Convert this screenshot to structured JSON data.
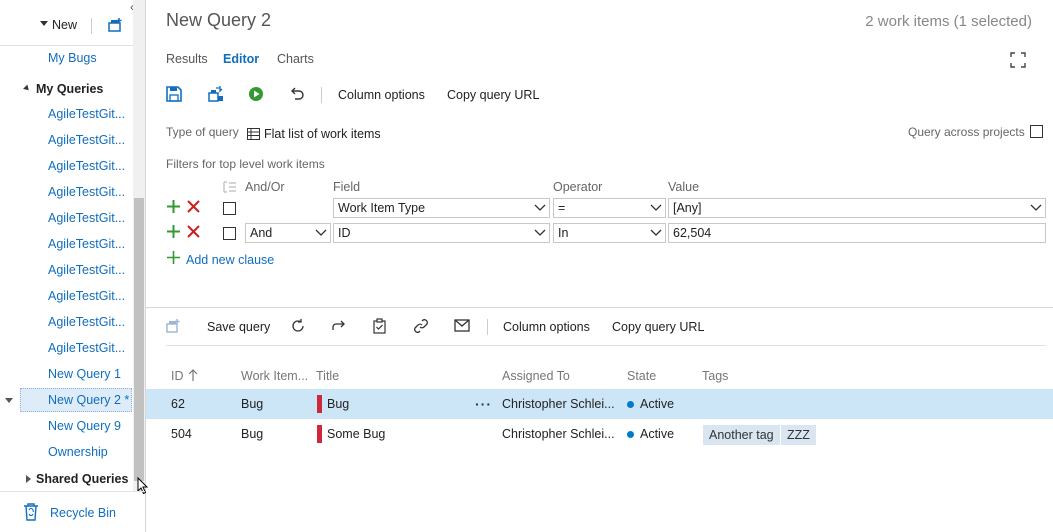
{
  "sidebar": {
    "new_label": "New",
    "items_top": [
      {
        "label": "My Bugs"
      }
    ],
    "my_queries_heading": "My Queries",
    "queries": [
      {
        "label": "AgileTestGit..."
      },
      {
        "label": "AgileTestGit..."
      },
      {
        "label": "AgileTestGit..."
      },
      {
        "label": "AgileTestGit..."
      },
      {
        "label": "AgileTestGit..."
      },
      {
        "label": "AgileTestGit..."
      },
      {
        "label": "AgileTestGit..."
      },
      {
        "label": "AgileTestGit..."
      },
      {
        "label": "AgileTestGit..."
      },
      {
        "label": "AgileTestGit..."
      },
      {
        "label": "New Query 1"
      },
      {
        "label": "New Query 2 *"
      },
      {
        "label": "New Query 9"
      },
      {
        "label": "Ownership"
      }
    ],
    "shared_queries_heading": "Shared Queries",
    "recycle_bin_label": "Recycle Bin"
  },
  "header": {
    "title": "New Query 2",
    "count": "2 work items (1 selected)"
  },
  "tabs": [
    {
      "label": "Results"
    },
    {
      "label": "Editor"
    },
    {
      "label": "Charts"
    }
  ],
  "editor_toolbar": {
    "column_options": "Column options",
    "copy_query_url": "Copy query URL"
  },
  "query_type": {
    "label": "Type of query",
    "value": "Flat list of work items",
    "across_projects": "Query across projects"
  },
  "filters": {
    "heading": "Filters for top level work items",
    "col_andor": "And/Or",
    "col_field": "Field",
    "col_operator": "Operator",
    "col_value": "Value",
    "clauses": [
      {
        "andor": "",
        "field": "Work Item Type",
        "operator": "=",
        "value": "[Any]"
      },
      {
        "andor": "And",
        "field": "ID",
        "operator": "In",
        "value": "62,504"
      }
    ],
    "add_clause": "Add new clause"
  },
  "results_toolbar": {
    "save_query": "Save query",
    "column_options": "Column options",
    "copy_query_url": "Copy query URL"
  },
  "results": {
    "columns": [
      "ID",
      "Work Item...",
      "Title",
      "Assigned To",
      "State",
      "Tags"
    ],
    "rows": [
      {
        "id": "62",
        "type": "Bug",
        "title": "Bug",
        "assigned": "Christopher Schlei...",
        "state": "Active",
        "tags": []
      },
      {
        "id": "504",
        "type": "Bug",
        "title": "Some Bug",
        "assigned": "Christopher Schlei...",
        "state": "Active",
        "tags": [
          "Another tag",
          "ZZZ"
        ]
      }
    ]
  },
  "colors": {
    "accent": "#106ebe",
    "bug_red": "#cc293d",
    "selected_row": "#cde6f7",
    "state_active": "#007acc",
    "play_green": "#339933"
  }
}
